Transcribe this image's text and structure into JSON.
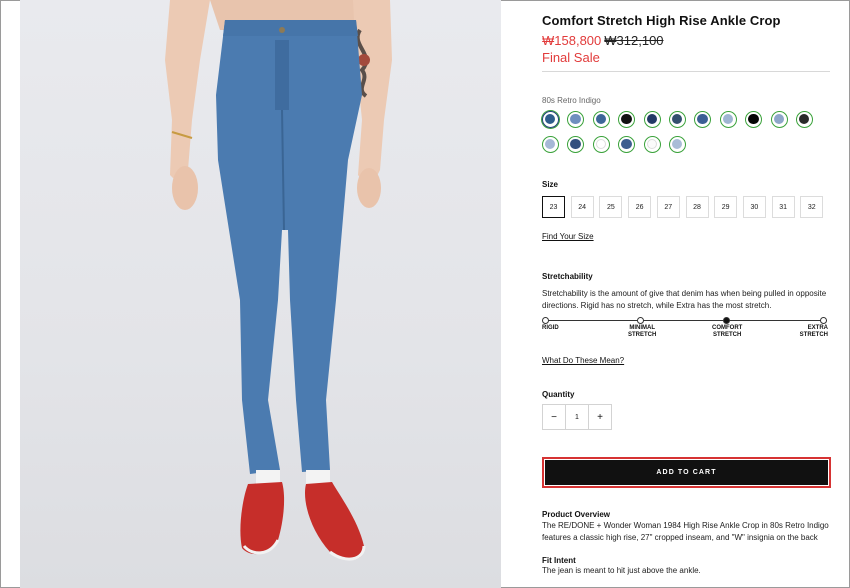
{
  "product": {
    "title": "Comfort Stretch High Rise Ankle Crop",
    "sale_price": "₩158,800",
    "original_price": "₩312,100",
    "final_sale": "Final Sale",
    "image_alt": "Model wearing light-wash high rise ankle crop jeans with red sneakers"
  },
  "color": {
    "selected_name": "80s Retro Indigo",
    "swatches": [
      {
        "name": "swatch-1",
        "color": "#2f5d8c",
        "selected": true
      },
      {
        "name": "swatch-2",
        "color": "#6f8fbf"
      },
      {
        "name": "swatch-3",
        "color": "#3d6798"
      },
      {
        "name": "swatch-4",
        "color": "#111111"
      },
      {
        "name": "swatch-5",
        "color": "#233a66"
      },
      {
        "name": "swatch-6",
        "color": "#34506f"
      },
      {
        "name": "swatch-7",
        "color": "#3b5f94"
      },
      {
        "name": "swatch-8",
        "color": "#9fb5d2"
      },
      {
        "name": "swatch-9",
        "color": "#050505"
      },
      {
        "name": "swatch-10",
        "color": "#8ea6c9"
      },
      {
        "name": "swatch-11",
        "color": "#2a2a2a"
      },
      {
        "name": "swatch-12",
        "color": "#a6b8d6"
      },
      {
        "name": "swatch-13",
        "color": "#33507e"
      },
      {
        "name": "swatch-14",
        "color": "#ffffff"
      },
      {
        "name": "swatch-15",
        "color": "#3d5e8f"
      },
      {
        "name": "swatch-16",
        "color": "#fbfbfb"
      },
      {
        "name": "swatch-17",
        "color": "#a9bcd7"
      }
    ]
  },
  "size": {
    "label": "Size",
    "options": [
      "23",
      "24",
      "25",
      "26",
      "27",
      "28",
      "29",
      "30",
      "31",
      "32"
    ],
    "selected": "23",
    "find_link": "Find Your Size"
  },
  "stretch": {
    "label": "Stretchability",
    "description": "Stretchability is the amount of give that denim has when being pulled in opposite directions. Rigid has no stretch, while Extra has the most stretch.",
    "levels": [
      {
        "line1": "RIGID",
        "line2": ""
      },
      {
        "line1": "MINIMAL",
        "line2": "STRETCH"
      },
      {
        "line1": "COMFORT",
        "line2": "STRETCH"
      },
      {
        "line1": "EXTRA",
        "line2": "STRETCH"
      }
    ],
    "selected_level": "COMFORT STRETCH",
    "meaning_link": "What Do These Mean?"
  },
  "quantity": {
    "label": "Quantity",
    "minus": "−",
    "value": "1",
    "plus": "+"
  },
  "cart": {
    "button": "ADD TO CART"
  },
  "overview": {
    "heading": "Product Overview",
    "text": "The RE/DONE + Wonder Woman 1984 High Rise Ankle Crop in 80s Retro Indigo features a classic high rise, 27\" cropped inseam, and \"W\" insignia on the back"
  },
  "fit": {
    "heading": "Fit Intent",
    "text": "The jean is meant to hit just above the ankle."
  },
  "colors": {
    "sale_red": "#e23b3b",
    "cart_black": "#111111",
    "cart_outline": "#d63333",
    "swatch_ring": "#3aa23a"
  }
}
